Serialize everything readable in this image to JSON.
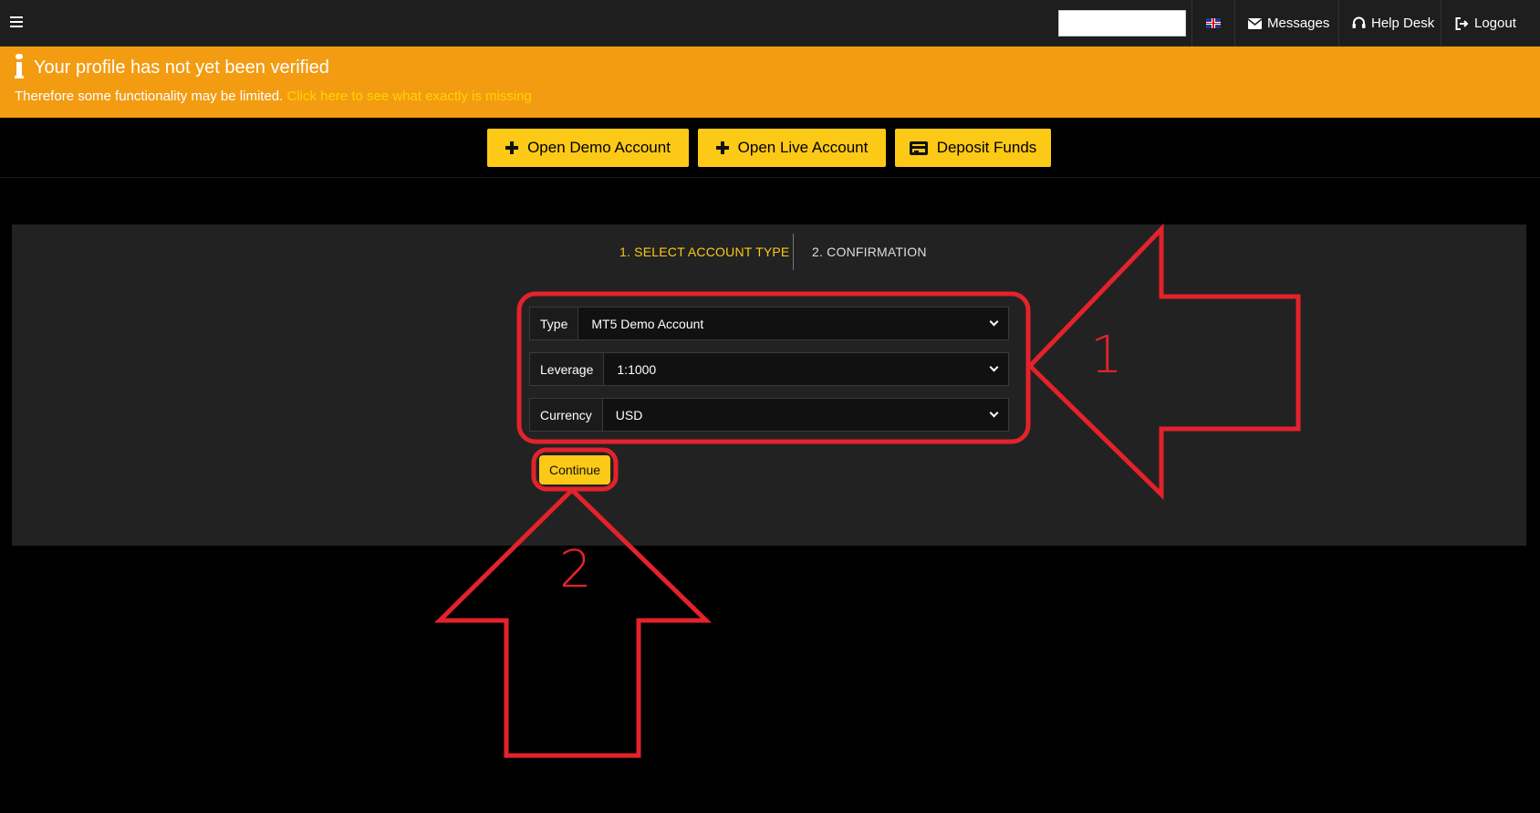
{
  "topbar": {
    "menu_icon": "hamburger-icon",
    "search_value": "",
    "language_icon": "uk-flag-icon",
    "messages_label": "Messages",
    "helpdesk_label": "Help Desk",
    "logout_label": "Logout"
  },
  "alert": {
    "title": "Your profile has not yet been verified",
    "text": "Therefore some functionality may be limited.",
    "link": "Click here to see what exactly is missing",
    "color": "#f39c12"
  },
  "actions": {
    "open_demo": "Open Demo Account",
    "open_live": "Open Live Account",
    "deposit": "Deposit Funds"
  },
  "wizard": {
    "step1": "1.  SELECT ACCOUNT TYPE",
    "step2": "2. CONFIRMATION",
    "fields": {
      "type_label": "Type",
      "type_value": "MT5 Demo Account",
      "leverage_label": "Leverage",
      "leverage_value": "1:1000",
      "currency_label": "Currency",
      "currency_value": "USD"
    },
    "continue_label": "Continue"
  },
  "annotations": {
    "marker_1": "1",
    "marker_2": "2",
    "color": "#e3222c"
  },
  "accent_color": "#fcc916"
}
